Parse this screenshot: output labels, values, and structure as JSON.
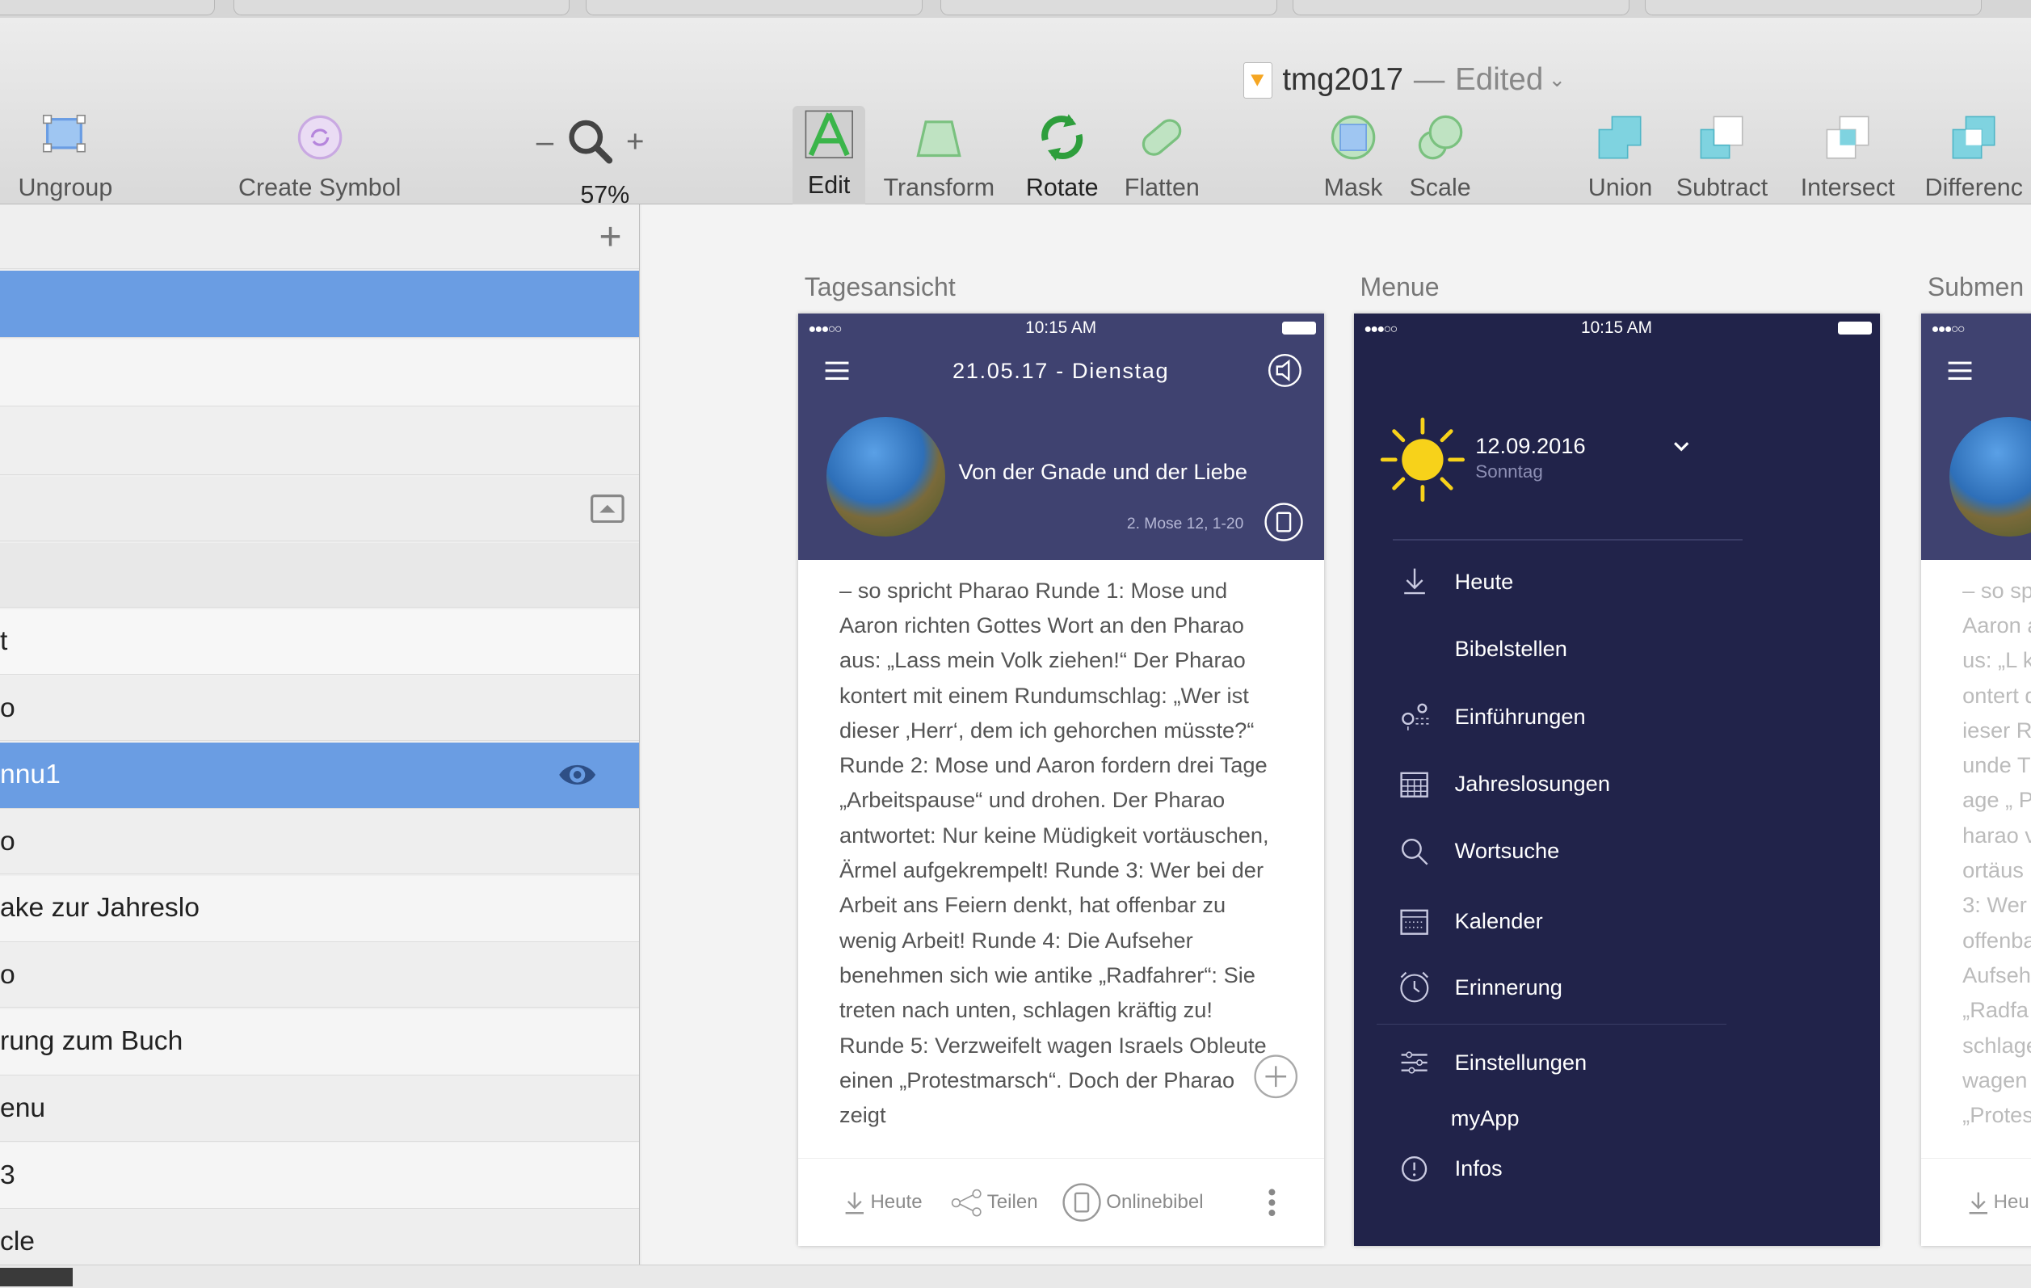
{
  "window": {
    "title": "tmg2017",
    "separator": "—",
    "status": "Edited"
  },
  "toolbar": {
    "ungroup": "Ungroup",
    "create_symbol": "Create Symbol",
    "zoom_minus": "–",
    "zoom_plus": "+",
    "zoom_level": "57%",
    "edit": "Edit",
    "transform": "Transform",
    "rotate": "Rotate",
    "flatten": "Flatten",
    "mask": "Mask",
    "scale": "Scale",
    "union": "Union",
    "subtract": "Subtract",
    "intersect": "Intersect",
    "difference": "Differenc"
  },
  "sidebar": {
    "add": "+",
    "layers": [
      "t",
      "o",
      "nnu1",
      "o",
      "ake zur Jahreslo",
      "o",
      "rung zum Buch",
      "enu",
      "3",
      "cle"
    ]
  },
  "artboards": {
    "a1": "Tagesansicht",
    "a2": "Menue",
    "a3": "Submen"
  },
  "phone1": {
    "time": "10:15 AM",
    "date": "21.05.17 - Dienstag",
    "title": "Von der Gnade und der Liebe",
    "reference": "2. Mose 12, 1-20",
    "text": "– so spricht Pharao Runde 1: Mose und Aaron richten Gottes Wort an den Pharao aus: „Lass mein Volk ziehen!“ Der Pharao kontert mit einem Rundumschlag: „Wer ist dieser ‚Herr‘, dem ich gehorchen müsste?“ Runde 2: Mose und Aaron fordern drei Tage „Arbeitspause“ und drohen. Der Pharao antwortet: Nur keine Müdigkeit vortäuschen, Ärmel aufgekrempelt! Runde 3: Wer bei der Arbeit ans Feiern denkt, hat offenbar zu wenig Arbeit! Runde 4: Die Aufseher benehmen sich wie antike „Radfahrer“: Sie treten nach unten, schlagen kräftig zu! Runde 5: Verzweifelt wagen Israels Obleute einen „Protestmarsch“. Doch der Pharao zeigt",
    "btn_today": "Heute",
    "btn_share": "Teilen",
    "btn_online": "Onlinebibel"
  },
  "phone2": {
    "time": "10:15 AM",
    "date": "12.09.2016",
    "weekday": "Sonntag",
    "items": [
      "Heute",
      "Bibelstellen",
      "Einführungen",
      "Jahreslosungen",
      "Wortsuche",
      "Kalender",
      "Erinnerung",
      "Einstellungen",
      "myApp",
      "Infos"
    ]
  },
  "phone3": {
    "text": "– so sp Aaron aus: „L kontert dieser Runde Tage „ Pharao vortäus 3: Wer offenba Aufseh „Radfa schlage wagen „Protes",
    "btn_today": "Heu"
  },
  "colors": {
    "accent": "#6a9de3",
    "phone_header": "#3f4270",
    "menu_bg": "#21234a"
  }
}
